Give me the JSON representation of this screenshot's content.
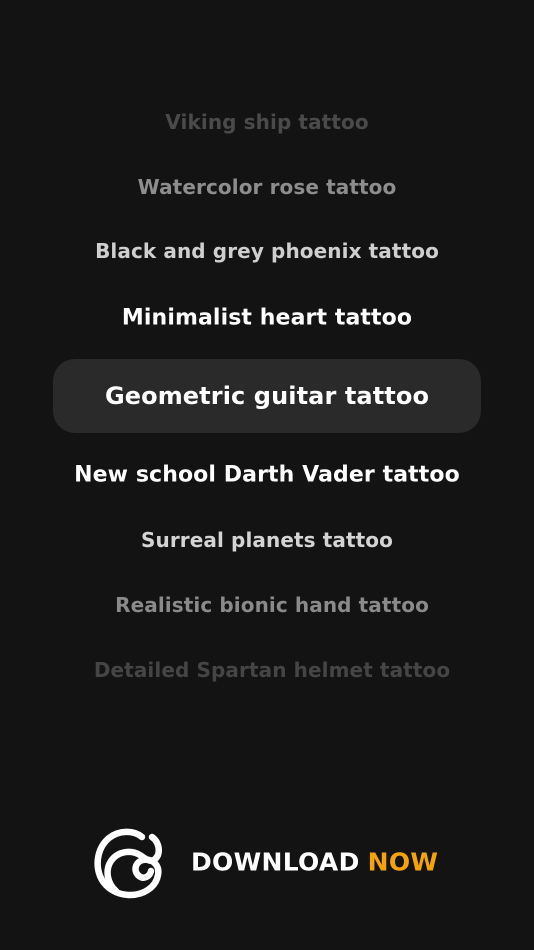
{
  "picker": {
    "items": [
      {
        "label": "Viking ship tattoo",
        "color": "#4a4a4a"
      },
      {
        "label": "Watercolor rose tattoo",
        "color": "#8d8d8d"
      },
      {
        "label": "Black and grey phoenix tattoo",
        "color": "#cfcfcf"
      },
      {
        "label": "Minimalist heart tattoo",
        "color": "#ffffff"
      },
      {
        "label": "Geometric guitar tattoo",
        "color": "#ffffff",
        "selected": true
      },
      {
        "label": "New school Darth Vader tattoo",
        "color": "#ffffff"
      },
      {
        "label": "Surreal planets tattoo",
        "color": "#d4d4d4"
      },
      {
        "label": "Realistic bionic hand tattoo",
        "color": "#8a8a8a"
      },
      {
        "label": "Detailed Spartan helmet tattoo",
        "color": "#454545"
      }
    ],
    "selected_bg_color": "#2a2a2b"
  },
  "footer": {
    "logo_icon": "app-logo-icon",
    "cta_download": "DOWNLOAD",
    "cta_now": "NOW",
    "accent_color": "#f5a30b"
  }
}
